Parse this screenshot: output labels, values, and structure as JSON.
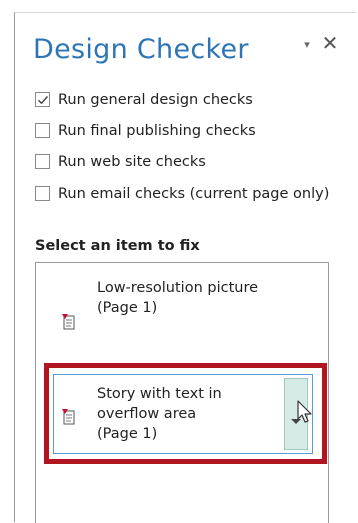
{
  "pane": {
    "title": "Design Checker",
    "menu_glyph": "▾",
    "close_glyph": "✕"
  },
  "options": [
    {
      "label": "Run general design checks",
      "checked": true
    },
    {
      "label": "Run final publishing checks",
      "checked": false
    },
    {
      "label": "Run web site checks",
      "checked": false
    },
    {
      "label": "Run email checks (current page only)",
      "checked": false
    }
  ],
  "section": {
    "label": "Select an item to fix"
  },
  "items": [
    {
      "title": "Low-resolution picture",
      "page": "(Page 1)",
      "icon": "picture-issue-icon",
      "selected": false
    },
    {
      "title": "Story with text in overflow area",
      "page": "(Page 1)",
      "icon": "text-issue-icon",
      "selected": true
    }
  ],
  "colors": {
    "title": "#2e75b6",
    "highlight_border": "#b01520",
    "selection_border": "#5b9bd5",
    "dropdown_fill": "#d6ebe5"
  }
}
